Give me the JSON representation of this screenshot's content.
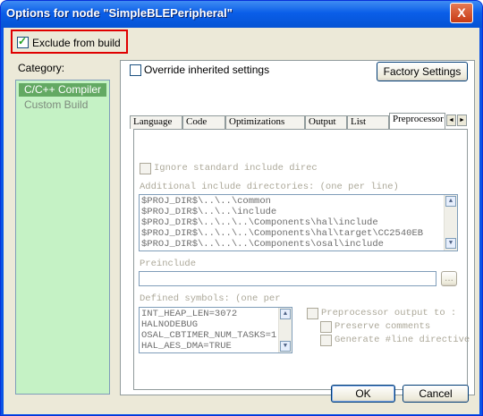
{
  "window": {
    "title": "Options for node \"SimpleBLEPeripheral\"",
    "close_glyph": "X"
  },
  "exclude_from_build": {
    "label": "Exclude from build",
    "checked": true
  },
  "category": {
    "label": "Category:",
    "items": [
      {
        "label": "C/C++ Compiler",
        "selected": true
      },
      {
        "label": "Custom Build",
        "selected": false
      }
    ]
  },
  "override": {
    "label": "Override inherited settings",
    "checked": false
  },
  "factory_settings_label": "Factory Settings",
  "tabs": [
    "Language",
    "Code",
    "Optimizations",
    "Output",
    "List",
    "Preprocessor"
  ],
  "tab_arrows": {
    "left": "◄",
    "right": "►"
  },
  "preprocessor": {
    "ignore_std_include": {
      "label": "Ignore standard include direc",
      "checked": false,
      "enabled": false
    },
    "include_dirs_label": "Additional include directories: (one per line)",
    "include_dirs": [
      "$PROJ_DIR$\\..\\..\\common",
      "$PROJ_DIR$\\..\\..\\include",
      "$PROJ_DIR$\\..\\..\\..\\Components\\hal\\include",
      "$PROJ_DIR$\\..\\..\\..\\Components\\hal\\target\\CC2540EB",
      "$PROJ_DIR$\\..\\..\\..\\Components\\osal\\include"
    ],
    "preinclude_label": "Preinclude",
    "preinclude_value": "",
    "browse_label": "...",
    "defined_symbols_label": "Defined symbols: (one per",
    "defined_symbols": [
      "INT_HEAP_LEN=3072",
      "HALNODEBUG",
      "OSAL_CBTIMER_NUM_TASKS=1",
      "HAL_AES_DMA=TRUE"
    ],
    "preprocessor_output": {
      "label": "Preprocessor output to :",
      "checked": false
    },
    "preserve_comments": {
      "label": "Preserve comments",
      "checked": false
    },
    "generate_line": {
      "label": "Generate #line directive",
      "checked": false
    }
  },
  "ok_label": "OK",
  "cancel_label": "Cancel",
  "scroll_glyphs": {
    "up": "▲",
    "down": "▼"
  }
}
